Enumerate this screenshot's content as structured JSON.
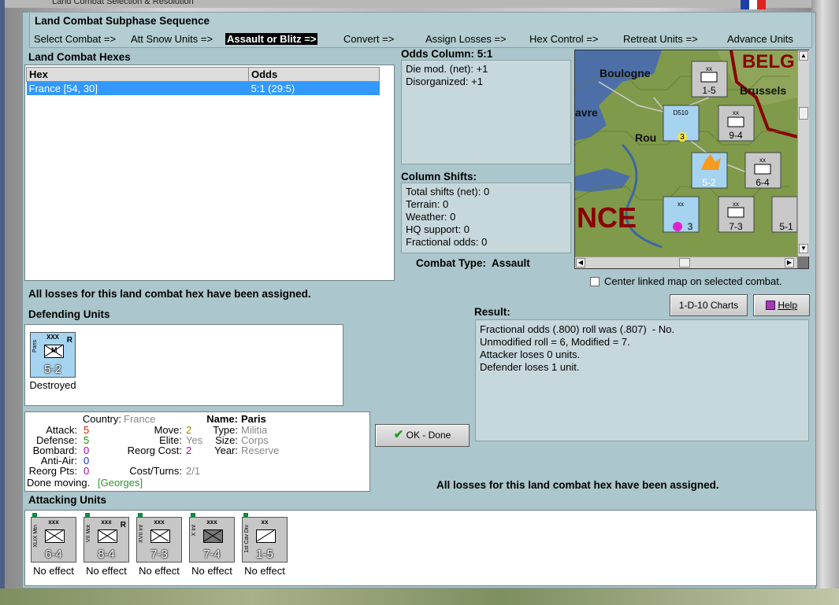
{
  "window": {
    "title": "Land Combat Selection & Resolution"
  },
  "subphase": {
    "heading": "Land Combat Subphase Sequence",
    "steps": [
      "Select Combat =>",
      "Att Snow Units =>",
      "Assault or Blitz =>",
      "Convert =>",
      "Assign Losses =>",
      "Hex Control =>",
      "Retreat Units =>",
      "Advance Units"
    ]
  },
  "hexes": {
    "heading": "Land Combat Hexes",
    "columns": [
      "Hex",
      "Odds"
    ],
    "rows": [
      {
        "hex": "France [54, 30]",
        "odds": "5:1 (29:5)"
      }
    ]
  },
  "odds": {
    "heading": "Odds Column: 5:1",
    "lines": [
      "Die mod. (net): +1",
      "Disorganized: +1"
    ]
  },
  "shifts": {
    "heading": "Column Shifts:",
    "lines": [
      "Total shifts (net): 0",
      "Terrain: 0",
      "Weather: 0",
      "HQ support: 0",
      "Fractional odds: 0"
    ]
  },
  "combat_type": "Combat Type:  Assault",
  "map": {
    "labels": [
      "BELG",
      "Boulogne",
      "Brussels",
      "avre",
      "Rou",
      "NCE"
    ],
    "counters": [
      {
        "size": "xx",
        "value": "1-5"
      },
      {
        "name": "D510",
        "value": "3"
      },
      {
        "size": "xx",
        "value": "9-4"
      },
      {
        "value": "5-2"
      },
      {
        "size": "xx",
        "value": "6-4"
      },
      {
        "size": "xx",
        "value": "3"
      },
      {
        "size": "xx",
        "value": "7-3"
      },
      {
        "value": "5-1"
      }
    ]
  },
  "center_checkbox": {
    "label": "Center linked map on selected combat.",
    "checked": false
  },
  "losses_msg_top": "All losses for this land combat hex have been assigned.",
  "losses_msg_bottom": "All losses for this land combat hex have been assigned.",
  "buttons": {
    "charts": "1-D-10 Charts",
    "help": "Help",
    "ok": "OK - Done"
  },
  "result": {
    "heading": "Result:",
    "lines": [
      "Fractional odds (.800) roll was (.807)  - No.",
      "Unmodified roll = 6, Modified = 7.",
      "Attacker loses 0 units.",
      "Defender loses 1 unit."
    ]
  },
  "defending": {
    "heading": "Defending Units",
    "units": [
      {
        "size": "XXX",
        "name": "Paris",
        "value": "5-2",
        "reorg": "R",
        "symbol": "M",
        "status": "Destroyed"
      }
    ]
  },
  "details": {
    "country_label": "Country:",
    "country": "France",
    "attack_label": "Attack:",
    "attack": "5",
    "defense_label": "Defense:",
    "defense": "5",
    "bombard_label": "Bombard:",
    "bombard": "0",
    "antiair_label": "Anti-Air:",
    "antiair": "0",
    "reorgpts_label": "Reorg Pts:",
    "reorgpts": "0",
    "move_label": "Move:",
    "move": "2",
    "elite_label": "Elite:",
    "elite": "Yes",
    "reorgcost_label": "Reorg Cost:",
    "reorgcost": "2",
    "costturns_label": "Cost/Turns:",
    "costturns": "2/1",
    "name_label": "Name:",
    "name": "Paris",
    "type_label": "Type:",
    "type": "Militia",
    "size_label": "Size:",
    "size": "Corps",
    "year_label": "Year:",
    "year": "Reserve",
    "done_moving": "Done moving.",
    "leader": "[Georges]"
  },
  "attacking": {
    "heading": "Attacking Units",
    "units": [
      {
        "size": "xxx",
        "name": "XLIX Mtn",
        "value": "6-4",
        "reorg": "",
        "status": "No effect"
      },
      {
        "size": "xxx",
        "name": "VII Mot",
        "value": "8-4",
        "reorg": "R",
        "status": "No effect"
      },
      {
        "size": "xxx",
        "name": "XVII Inf",
        "value": "7-3",
        "reorg": "",
        "status": "No effect"
      },
      {
        "size": "xxx",
        "name": "X Inf",
        "value": "7-4",
        "reorg": "",
        "status": "No effect"
      },
      {
        "size": "xx",
        "name": "1st Cav Div",
        "value": "1-5",
        "reorg": "",
        "status": "No effect"
      }
    ]
  },
  "colors": {
    "panel": "#abc6cc",
    "selection": "#3399ff",
    "attack_red": "#cc2200",
    "destroyed_blue": "#a6d3ef"
  }
}
